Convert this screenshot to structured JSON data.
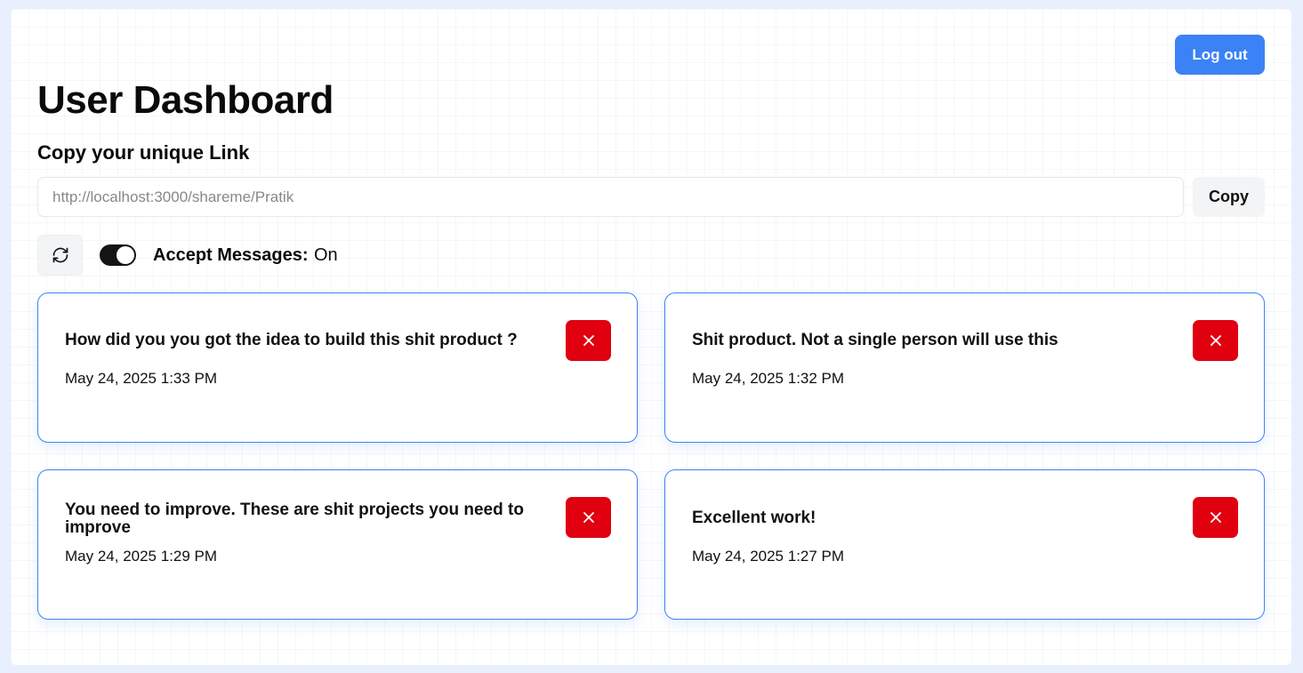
{
  "header": {
    "title": "User Dashboard",
    "logout_label": "Log out"
  },
  "link_section": {
    "heading": "Copy your unique Link",
    "url": "http://localhost:3000/shareme/Pratik",
    "copy_label": "Copy"
  },
  "controls": {
    "accept_label": "Accept Messages:",
    "accept_status": "On",
    "accept_enabled": true,
    "refresh_icon": "refresh-icon"
  },
  "messages": [
    {
      "text": "How did you you got the idea to build this shit product ?",
      "date": "May 24, 2025 1:33 PM"
    },
    {
      "text": "Shit product. Not a single person will use this",
      "date": "May 24, 2025 1:32 PM"
    },
    {
      "text": "You need to improve. These are shit projects you need to improve",
      "date": "May 24, 2025 1:29 PM"
    },
    {
      "text": "Excellent work!",
      "date": "May 24, 2025 1:27 PM"
    }
  ],
  "colors": {
    "primary": "#3b82f6",
    "danger": "#e00010",
    "toggle_on": "#141414"
  }
}
